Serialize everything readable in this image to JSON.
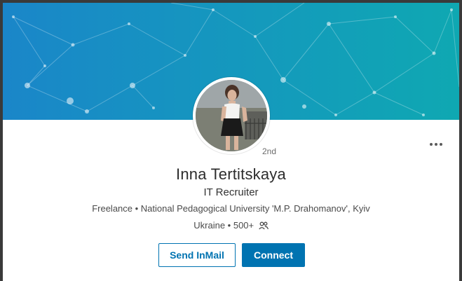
{
  "profile": {
    "name": "Inna Tertitskaya",
    "headline": "IT Recruiter",
    "subline": "Freelance • National Pedagogical University 'M.P. Drahomanov', Kyiv",
    "location": "Ukraine",
    "connections": "• 500+",
    "degree": "2nd"
  },
  "actions": {
    "send_inmail": "Send InMail",
    "connect": "Connect"
  },
  "icons": {
    "more": "more-options-icon",
    "connections": "people-icon"
  },
  "colors": {
    "accent": "#0073b1",
    "banner_start": "#1a86c9",
    "banner_end": "#0fa8b2"
  }
}
